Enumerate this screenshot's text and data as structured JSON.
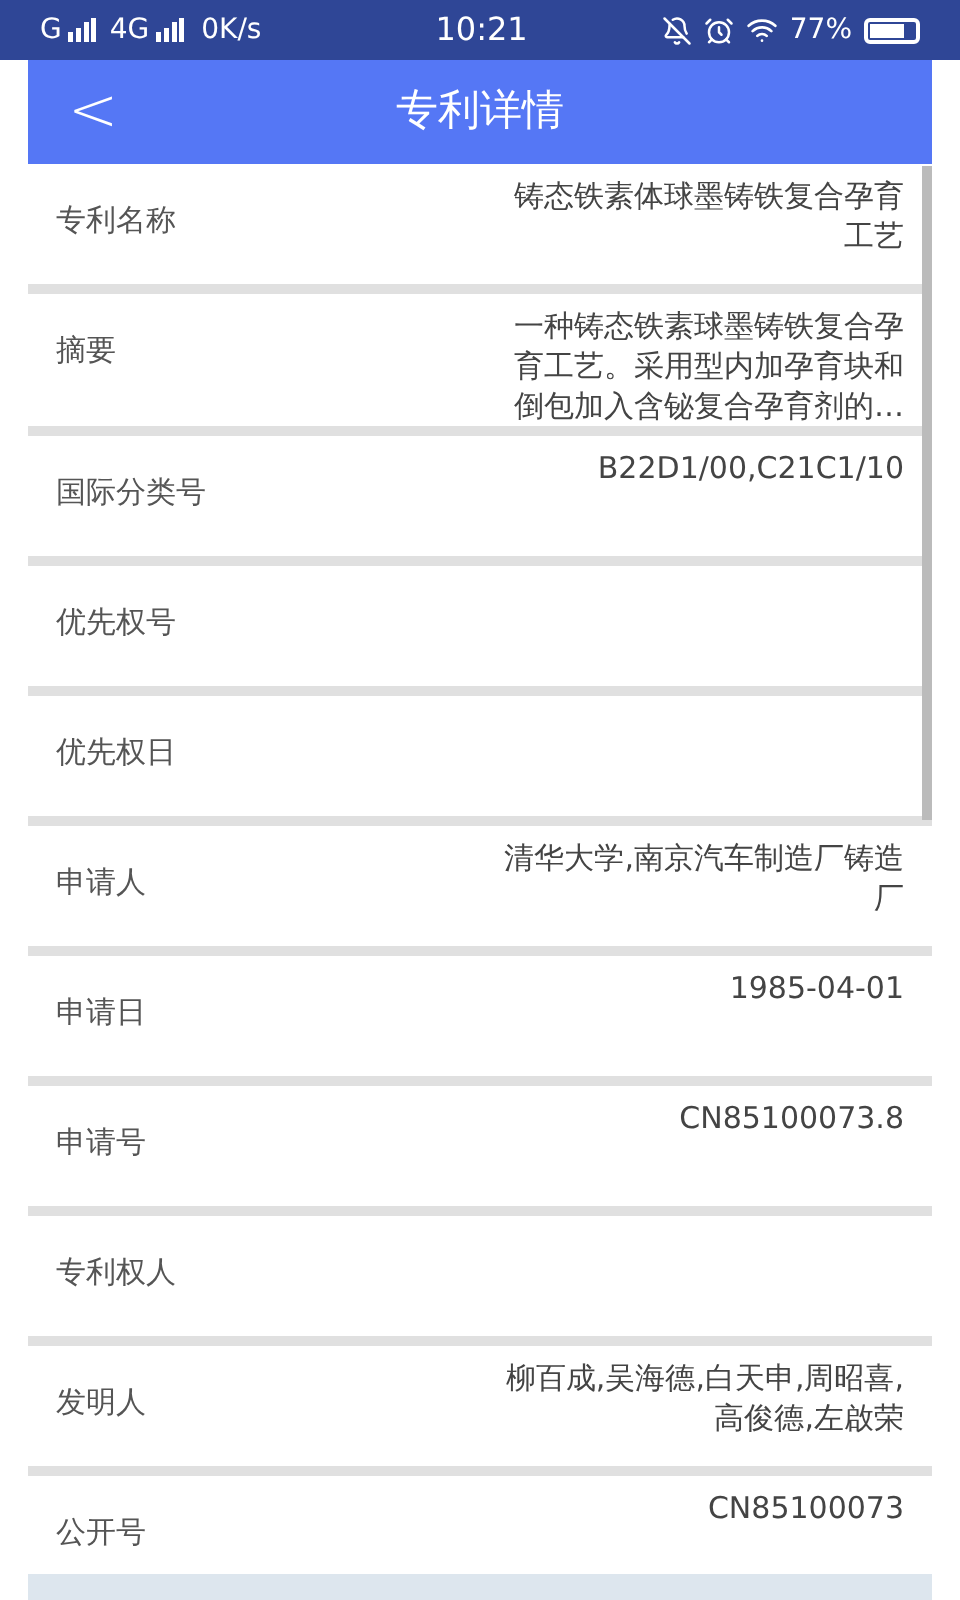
{
  "status_bar": {
    "network_1": "G",
    "network_2": "4G",
    "speed": "0K/s",
    "time": "10:21",
    "battery": "77%"
  },
  "header": {
    "back": "<",
    "title": "专利详情"
  },
  "fields": [
    {
      "label": "专利名称",
      "value": "铸态铁素体球墨铸铁复合孕育工艺"
    },
    {
      "label": "摘要",
      "value": "一种铸态铁素球墨铸铁复合孕育工艺。采用型内加孕育块和倒包加入含铋复合孕育剂的…"
    },
    {
      "label": "国际分类号",
      "value": "B22D1/00,C21C1/10"
    },
    {
      "label": "优先权号"
    },
    {
      "label": "优先权日"
    },
    {
      "label": "申请人",
      "value": "清华大学,南京汽车制造厂铸造厂"
    },
    {
      "label": "申请日",
      "value": "1985-04-01"
    },
    {
      "label": "申请号",
      "value": "CN85100073.8"
    },
    {
      "label": "专利权人"
    },
    {
      "label": "发明人",
      "value": "柳百成,吴海德,白天申,周昭喜,高俊德,左啟荣"
    },
    {
      "label": "公开号",
      "value": "CN85100073"
    }
  ]
}
